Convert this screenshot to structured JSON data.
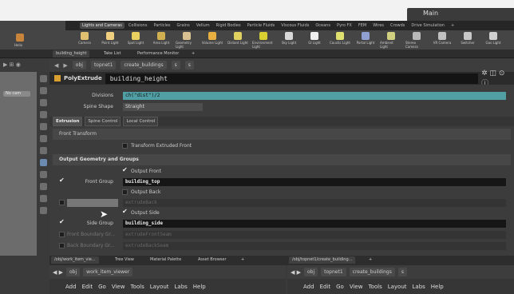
{
  "titlebar": {
    "desktop": "Main"
  },
  "shelf_tabs": [
    "Lights and Cameras",
    "Collisions",
    "Particles",
    "Grains",
    "Vellum",
    "Rigid Bodies",
    "Particle Fluids",
    "Viscous Fluids",
    "Oceans",
    "Pyro FX",
    "FEM",
    "Wires",
    "Crowds",
    "Drive Simulation",
    "+"
  ],
  "shelf_tools": [
    "Camera",
    "Point Light",
    "Spot Light",
    "Area Light",
    "Geometry Light",
    "Volume Light",
    "Distant Light",
    "Environment Light",
    "Sky Light",
    "GI Light",
    "Caustic Light",
    "Portal Light",
    "Ambient Light",
    "Stereo Camera",
    "VR Camera",
    "Switcher",
    "Gas Light"
  ],
  "left_shelf": {
    "label": "Helix"
  },
  "pane_tabs": [
    "building_height",
    "Take List",
    "Performance Monitor",
    "+"
  ],
  "path": {
    "obj": "obj",
    "net": "topnet1",
    "node": "create_buildings",
    "sop": "s",
    "leaf": "s"
  },
  "viewport": {
    "camera": "No cam"
  },
  "node": {
    "type": "PolyExtrude",
    "name": "building_height"
  },
  "params": {
    "divisions_label": "Divisions",
    "divisions_value": "ch(\"dist\")/2",
    "spine_label": "Spine Shape",
    "spine_value": "Straight",
    "tabs": [
      "Extrusion",
      "Spine Control",
      "Local Control"
    ],
    "front_transform": "Front Transform",
    "transform_extruded": "Transform Extruded Front",
    "output_section": "Output Geometry and Groups",
    "output_front": "Output Front",
    "front_group_label": "Front Group",
    "front_group_value": "building_top",
    "output_back": "Output Back",
    "back_group_value": "extrudeBack",
    "output_side": "Output Side",
    "side_group_label": "Side Group",
    "side_group_value": "building_side",
    "front_boundary_label": "Front Boundary Gr...",
    "front_boundary_value": "extrudeFrontSeam",
    "back_boundary_label": "Back Boundary Gr...",
    "back_boundary_value": "extrudeBackSeam"
  },
  "bottom_left": {
    "tabs": [
      "/obj/work_item_vie...",
      "Tree View",
      "Material Palette",
      "Asset Browser",
      "+"
    ],
    "obj": "obj",
    "viewer": "work_item_viewer",
    "menu": [
      "Add",
      "Edit",
      "Go",
      "View",
      "Tools",
      "Layout",
      "Labs",
      "Help"
    ]
  },
  "bottom_right": {
    "tabs": [
      "/obj/topnet1/create_building...",
      "+"
    ],
    "obj": "obj",
    "net": "topnet1",
    "node": "create_buildings",
    "leaf": "s",
    "menu": [
      "Add",
      "Edit",
      "Go",
      "View",
      "Tools",
      "Layout",
      "Labs",
      "Help"
    ]
  }
}
